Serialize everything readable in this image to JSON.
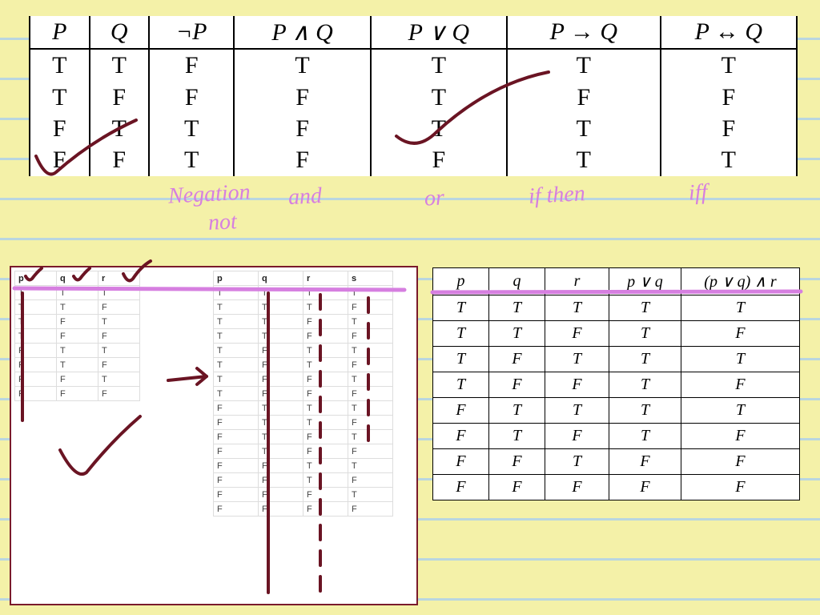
{
  "top": {
    "headers": [
      "P",
      "Q",
      "¬P",
      "P ∧ Q",
      "P ∨ Q",
      "P → Q",
      "P ↔ Q"
    ],
    "rows": [
      [
        "T",
        "T",
        "F",
        "T",
        "T",
        "T",
        "T"
      ],
      [
        "T",
        "F",
        "F",
        "F",
        "T",
        "F",
        "F"
      ],
      [
        "F",
        "T",
        "T",
        "F",
        "T",
        "T",
        "F"
      ],
      [
        "F",
        "F",
        "T",
        "F",
        "F",
        "T",
        "T"
      ]
    ]
  },
  "hand": {
    "neg": "Negation",
    "and": "and",
    "not": "not",
    "or": "or",
    "ifthen": "if then",
    "iff": "iff"
  },
  "mini1": {
    "headers": [
      "p",
      "q",
      "r"
    ],
    "rows": [
      [
        "T",
        "T",
        "T"
      ],
      [
        "T",
        "T",
        "F"
      ],
      [
        "T",
        "F",
        "T"
      ],
      [
        "T",
        "F",
        "F"
      ],
      [
        "F",
        "T",
        "T"
      ],
      [
        "F",
        "T",
        "F"
      ],
      [
        "F",
        "F",
        "T"
      ],
      [
        "F",
        "F",
        "F"
      ]
    ]
  },
  "mini2": {
    "headers": [
      "p",
      "q",
      "r",
      "s"
    ],
    "rows": [
      [
        "T",
        "T",
        "T",
        "T"
      ],
      [
        "T",
        "T",
        "T",
        "F"
      ],
      [
        "T",
        "T",
        "F",
        "T"
      ],
      [
        "T",
        "T",
        "F",
        "F"
      ],
      [
        "T",
        "F",
        "T",
        "T"
      ],
      [
        "T",
        "F",
        "T",
        "F"
      ],
      [
        "T",
        "F",
        "F",
        "T"
      ],
      [
        "T",
        "F",
        "F",
        "F"
      ],
      [
        "F",
        "T",
        "T",
        "T"
      ],
      [
        "F",
        "T",
        "T",
        "F"
      ],
      [
        "F",
        "T",
        "F",
        "T"
      ],
      [
        "F",
        "T",
        "F",
        "F"
      ],
      [
        "F",
        "F",
        "T",
        "T"
      ],
      [
        "F",
        "F",
        "T",
        "F"
      ],
      [
        "F",
        "F",
        "F",
        "T"
      ],
      [
        "F",
        "F",
        "F",
        "F"
      ]
    ]
  },
  "br": {
    "headers": [
      "p",
      "q",
      "r",
      "p ∨ q",
      "(p ∨ q) ∧ r"
    ],
    "rows": [
      [
        "T",
        "T",
        "T",
        "T",
        "T"
      ],
      [
        "T",
        "T",
        "F",
        "T",
        "F"
      ],
      [
        "T",
        "F",
        "T",
        "T",
        "T"
      ],
      [
        "T",
        "F",
        "F",
        "T",
        "F"
      ],
      [
        "F",
        "T",
        "T",
        "T",
        "T"
      ],
      [
        "F",
        "T",
        "F",
        "T",
        "F"
      ],
      [
        "F",
        "F",
        "T",
        "F",
        "F"
      ],
      [
        "F",
        "F",
        "F",
        "F",
        "F"
      ]
    ]
  }
}
